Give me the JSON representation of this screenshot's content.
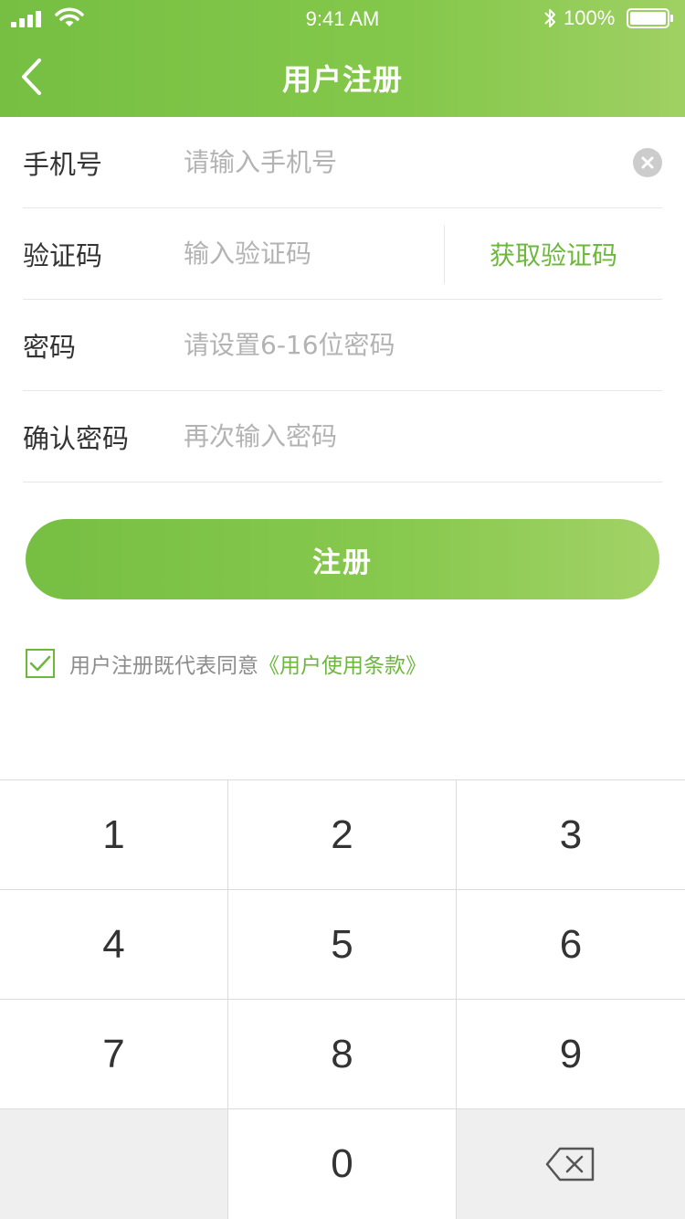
{
  "status_bar": {
    "time": "9:41 AM",
    "battery_percent": "100%",
    "battery_level": 1.0
  },
  "nav": {
    "title": "用户注册",
    "back_icon": "chevron-left-icon"
  },
  "form": {
    "phone": {
      "label": "手机号",
      "placeholder": "请输入手机号",
      "value": ""
    },
    "code": {
      "label": "验证码",
      "placeholder": "输入验证码",
      "value": "",
      "get_code_label": "获取验证码"
    },
    "password": {
      "label": "密码",
      "placeholder": "请设置6-16位密码",
      "value": ""
    },
    "confirm": {
      "label": "确认密码",
      "placeholder": "再次输入密码",
      "value": ""
    }
  },
  "register_button": {
    "label": "注册"
  },
  "agreement": {
    "checked": true,
    "text": "用户注册既代表同意",
    "link_text": "《用户使用条款》"
  },
  "keypad": {
    "keys": [
      "1",
      "2",
      "3",
      "4",
      "5",
      "6",
      "7",
      "8",
      "9",
      "",
      "0",
      "backspace-icon"
    ]
  },
  "colors": {
    "brand_green": "#76bf43",
    "brand_green_light": "#a2d266",
    "link_green": "#6cb83a",
    "placeholder_gray": "#b3b3b3",
    "divider_gray": "#e6e6e6"
  }
}
